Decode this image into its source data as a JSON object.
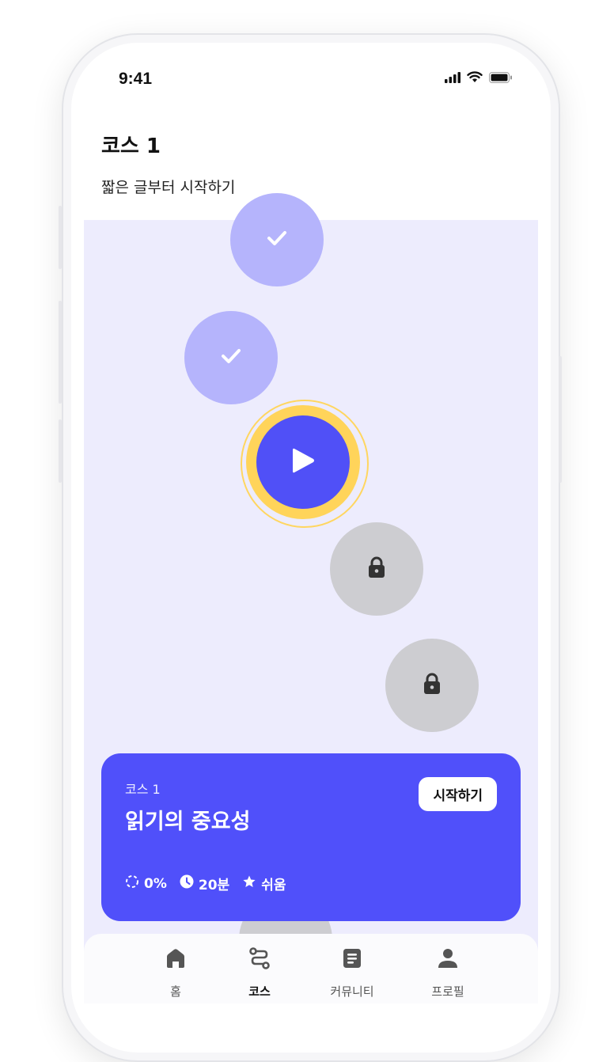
{
  "status_bar": {
    "time": "9:41"
  },
  "header": {
    "title": "코스 1",
    "subtitle": "짧은 글부터 시작하기"
  },
  "path_nodes": [
    {
      "state": "done",
      "icon": "check-icon"
    },
    {
      "state": "done",
      "icon": "check-icon"
    },
    {
      "state": "current",
      "icon": "play-icon"
    },
    {
      "state": "locked",
      "icon": "lock-icon"
    },
    {
      "state": "locked",
      "icon": "lock-icon"
    }
  ],
  "lesson_card": {
    "course_label": "코스 1",
    "title": "읽기의 중요성",
    "start_label": "시작하기",
    "progress": "0%",
    "duration": "20분",
    "difficulty": "쉬움"
  },
  "tab_bar": {
    "items": [
      {
        "label": "홈",
        "icon": "home-icon"
      },
      {
        "label": "코스",
        "icon": "route-icon",
        "active": true
      },
      {
        "label": "커뮤니티",
        "icon": "document-icon"
      },
      {
        "label": "프로필",
        "icon": "profile-icon"
      }
    ]
  },
  "colors": {
    "accent": "#5050FA",
    "done_node": "#B5B4FC",
    "locked_node": "#CDCDD1",
    "current_ring": "#FFD45A",
    "map_background": "#EDECFD"
  }
}
